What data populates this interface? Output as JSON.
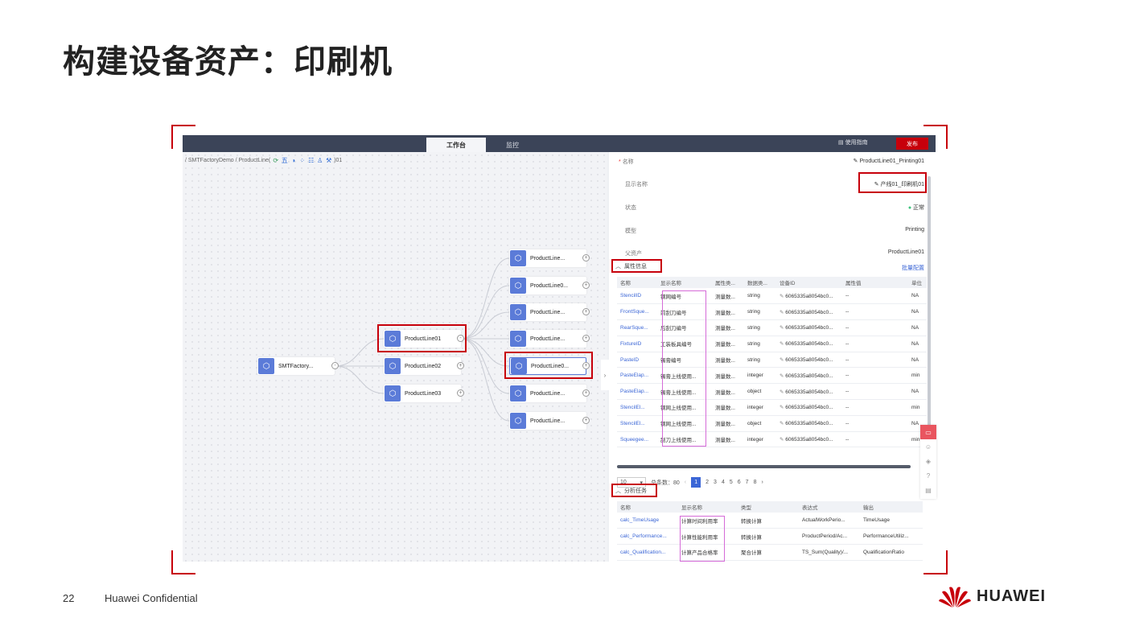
{
  "slide": {
    "title": "构建设备资产：印刷机",
    "page_number": "22",
    "confidential": "Huawei Confidential",
    "logo_text": "HUAWEI"
  },
  "app": {
    "tabs": [
      "工作台",
      "监控"
    ],
    "help_label": "使用指南",
    "publish_label": "发布",
    "breadcrumb_prefix": "/ SMTFactoryDemo / ProductLine(",
    "breadcrumb_suffix": ")01",
    "toolbar_icons": [
      "refresh-icon",
      "text-icon",
      "theme-icon",
      "link-icon",
      "layout-icon",
      "user-icon",
      "wrench-icon"
    ]
  },
  "graph": {
    "root": "SMTFactory...",
    "lines": [
      "ProductLine01",
      "ProductLine02",
      "ProductLine03"
    ],
    "devices": [
      "ProductLine...",
      "ProductLine0...",
      "ProductLine...",
      "ProductLine...",
      "ProductLine0...",
      "ProductLine...",
      "ProductLine..."
    ]
  },
  "details": {
    "name_label": "名称",
    "name_value": "ProductLine01_Printing01",
    "display_label": "显示名称",
    "display_value": "产线01_印刷机01",
    "status_label": "状态",
    "status_value": "正常",
    "model_label": "模型",
    "model_value": "Printing",
    "parent_label": "父资产",
    "parent_value": "ProductLine01",
    "status_color": "#3cc47c"
  },
  "attributes": {
    "section_label": "属性信息",
    "batch_label": "批量配置",
    "columns": [
      "名称",
      "显示名称",
      "属性类...",
      "数据类...",
      "设备ID",
      "属性值",
      "单位"
    ],
    "rows": [
      [
        "StencilID",
        "钢网编号",
        "测量数...",
        "string",
        "6065335a8054bc0...",
        "--",
        "NA"
      ],
      [
        "FrontSque...",
        "前刮刀编号",
        "测量数...",
        "string",
        "6065335a8054bc0...",
        "--",
        "NA"
      ],
      [
        "RearSque...",
        "后刮刀编号",
        "测量数...",
        "string",
        "6065335a8054bc0...",
        "--",
        "NA"
      ],
      [
        "FixtureID",
        "工装板具编号",
        "测量数...",
        "string",
        "6065335a8054bc0...",
        "--",
        "NA"
      ],
      [
        "PasteID",
        "锡膏编号",
        "测量数...",
        "string",
        "6065335a8054bc0...",
        "--",
        "NA"
      ],
      [
        "PasteElap...",
        "锡膏上线使用...",
        "测量数...",
        "integer",
        "6065335a8054bc0...",
        "--",
        "min"
      ],
      [
        "PasteElap...",
        "锡膏上线使用...",
        "测量数...",
        "object",
        "6065335a8054bc0...",
        "--",
        "NA"
      ],
      [
        "StencilEl...",
        "钢网上线使用...",
        "测量数...",
        "integer",
        "6065335a8054bc0...",
        "--",
        "min"
      ],
      [
        "StencilEl...",
        "钢网上线使用...",
        "测量数...",
        "object",
        "6065335a8054bc0...",
        "--",
        "NA"
      ],
      [
        "Squeegee...",
        "刮刀上线使用...",
        "测量数...",
        "integer",
        "6065335a8054bc0...",
        "--",
        "min"
      ]
    ],
    "pager": {
      "page_size": "10",
      "total": "总条数：80",
      "pages": [
        "1",
        "2",
        "3",
        "4",
        "5",
        "6",
        "7",
        "8"
      ],
      "current": "1"
    }
  },
  "analytics": {
    "section_label": "分析任务",
    "columns": [
      "名称",
      "显示名称",
      "类型",
      "表达式",
      "输出"
    ],
    "rows": [
      [
        "calc_TimeUsage",
        "计算时间利用率",
        "转换计算",
        "ActualWorkPerio...",
        "TimeUsage"
      ],
      [
        "calc_Performance...",
        "计算性能利用率",
        "转换计算",
        "ProductPeriod/Ac...",
        "PerformanceUtiliz..."
      ],
      [
        "calc_Qualification...",
        "计算产品合格率",
        "聚合计算",
        "TS_Sum(Quality)/...",
        "QualificationRatio"
      ]
    ]
  },
  "colors": {
    "accent": "#c7000b",
    "node": "#5b7bd8",
    "link": "#3b66d6",
    "topbar": "#3b4458"
  }
}
